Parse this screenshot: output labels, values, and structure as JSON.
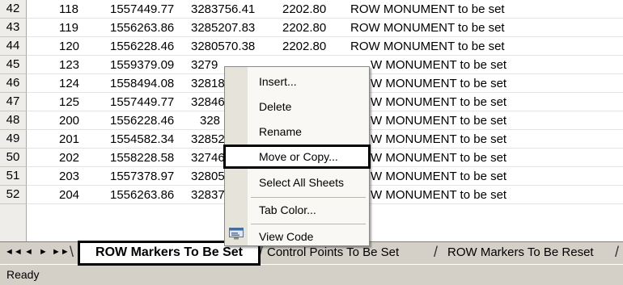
{
  "rows": [
    {
      "num": "42",
      "c1": "118",
      "c2": "1557449.77",
      "c3": "3283756.41",
      "c4": "2202.80",
      "c5": "ROW MONUMENT to be set"
    },
    {
      "num": "43",
      "c1": "119",
      "c2": "1556263.86",
      "c3": "3285207.83",
      "c4": "2202.80",
      "c5": "ROW MONUMENT to be set"
    },
    {
      "num": "44",
      "c1": "120",
      "c2": "1556228.46",
      "c3": "3280570.38",
      "c4": "2202.80",
      "c5": "ROW MONUMENT to be set"
    },
    {
      "num": "45",
      "c1": "123",
      "c2": "1559379.09",
      "c3": "3279",
      "c4": "",
      "c5": "W MONUMENT to be set"
    },
    {
      "num": "46",
      "c1": "124",
      "c2": "1558494.08",
      "c3": "32818",
      "c4": "",
      "c5": "W MONUMENT to be set"
    },
    {
      "num": "47",
      "c1": "125",
      "c2": "1557449.77",
      "c3": "32846",
      "c4": "",
      "c5": "W MONUMENT to be set"
    },
    {
      "num": "48",
      "c1": "200",
      "c2": "1556228.46",
      "c3": "328",
      "c4": "",
      "c5": "W MONUMENT to be set"
    },
    {
      "num": "49",
      "c1": "201",
      "c2": "1554582.34",
      "c3": "32852",
      "c4": "",
      "c5": "W MONUMENT to be set"
    },
    {
      "num": "50",
      "c1": "202",
      "c2": "1558228.58",
      "c3": "32746",
      "c4": "",
      "c5": "W MONUMENT to be set"
    },
    {
      "num": "51",
      "c1": "203",
      "c2": "1557378.97",
      "c3": "32805",
      "c4": "",
      "c5": "W MONUMENT to be set"
    },
    {
      "num": "52",
      "c1": "204",
      "c2": "1556263.86",
      "c3": "32837",
      "c4": "",
      "c5": "W MONUMENT to be set"
    }
  ],
  "tabs": {
    "active": "ROW Markers To Be Set",
    "second": "Control Points To Be Set",
    "third": "ROW Markers To Be Reset"
  },
  "nav": {
    "first": "◄◄",
    "prev": "◄",
    "next": "►",
    "last": "►►"
  },
  "status": "Ready",
  "context_menu": {
    "items": [
      "Insert...",
      "Delete",
      "Rename",
      "Move or Copy...",
      "Select All Sheets",
      "Tab Color...",
      "View Code"
    ],
    "selected": "Move or Copy..."
  }
}
